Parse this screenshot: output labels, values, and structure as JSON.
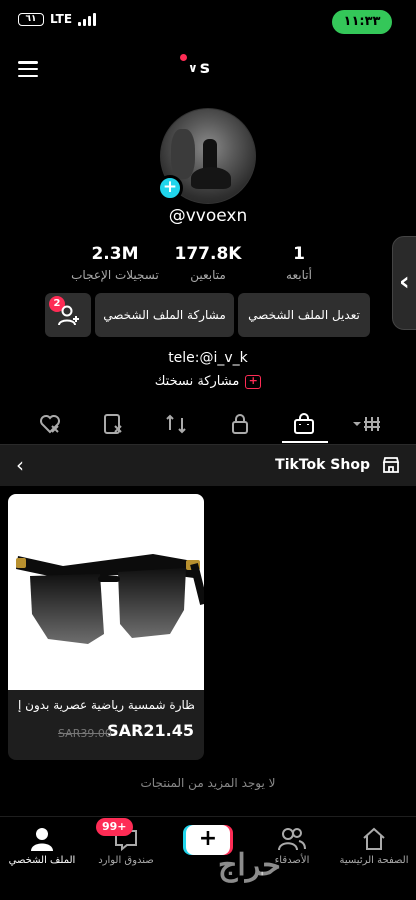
{
  "status_bar": {
    "battery": "٦١",
    "network": "LTE",
    "time": "١١:٣٣"
  },
  "header": {
    "account_initial": "s"
  },
  "profile": {
    "username": "@vvoexn",
    "stats": [
      {
        "value": "2.3M",
        "label": "تسجيلات الإعجاب"
      },
      {
        "value": "177.8K",
        "label": "متابعين"
      },
      {
        "value": "1",
        "label": "أتابعه"
      }
    ],
    "edit_profile": "تعديل الملف الشخصي",
    "share_profile": "مشاركة الملف الشخصي",
    "friend_requests_count": "2",
    "bio": "tele:@i_v_k",
    "share_copy": "مشاركة نسختك"
  },
  "shop": {
    "title": "TikTok Shop",
    "product": {
      "name": "نظارة شمسية رياضية عصرية بدون إ...",
      "price": "SAR21.45",
      "old_price": "SAR39.00"
    },
    "no_more": "لا يوجد المزيد من المنتجات"
  },
  "bottom_nav": {
    "home": "الصفحة الرئيسية",
    "friends": "الأصدقاء",
    "create": "+",
    "inbox": "صندوق الوارد",
    "inbox_badge": "99+",
    "profile": "الملف الشخصي"
  },
  "watermark": "حراج",
  "colors": {
    "accent_pink": "#fe2c55",
    "accent_cyan": "#20d5ec",
    "status_green": "#34c759"
  }
}
